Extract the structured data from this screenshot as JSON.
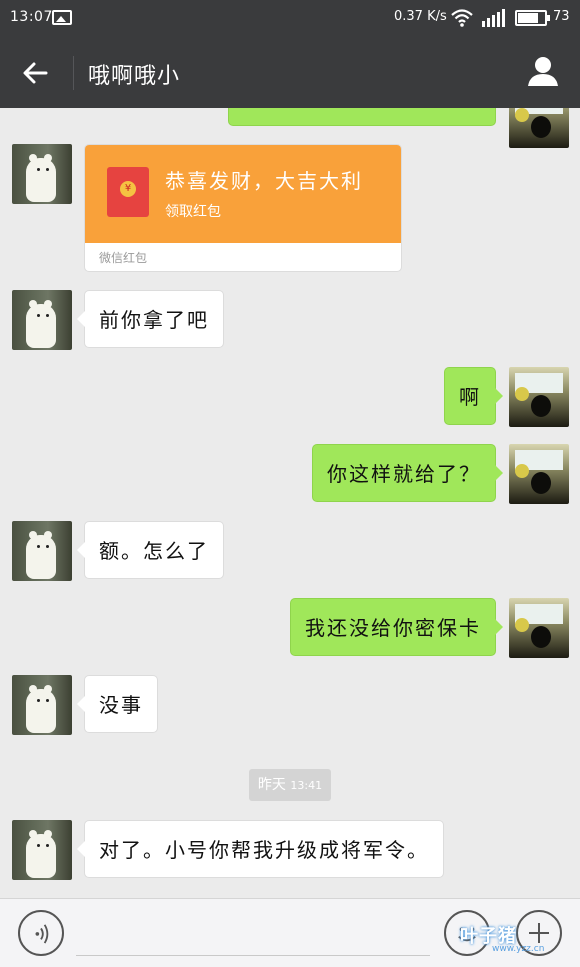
{
  "status_bar": {
    "time": "13:07",
    "net_speed": "0.37 K/s",
    "battery_level": "73"
  },
  "header": {
    "title": "哦啊哦小"
  },
  "red_packet": {
    "greeting": "恭喜发财，大吉大利",
    "action": "领取红包",
    "footer": "微信红包"
  },
  "messages": [
    {
      "side": "in",
      "text": "前你拿了吧"
    },
    {
      "side": "out",
      "text": "啊"
    },
    {
      "side": "out",
      "text": "你这样就给了？"
    },
    {
      "side": "in",
      "text": "额。怎么了"
    },
    {
      "side": "out",
      "text": "我还没给你密保卡"
    },
    {
      "side": "in",
      "text": "没事"
    },
    {
      "side": "in",
      "text": "对了。小号你帮我升级成将军令。"
    }
  ],
  "timestamp": {
    "day": "昨天",
    "time": "13:41"
  },
  "watermark": {
    "text": "叶子猪",
    "url": "www.yzz.cn"
  },
  "colors": {
    "header_bg": "#3a3b3d",
    "outgoing_bubble": "#a0e75a",
    "red_packet": "#f9a13a",
    "chat_bg": "#ebebeb"
  },
  "icons": [
    "back-arrow-icon",
    "person-icon",
    "voice-icon",
    "emoji-icon",
    "plus-icon",
    "wifi-icon",
    "signal-icon",
    "battery-icon",
    "gallery-icon"
  ]
}
